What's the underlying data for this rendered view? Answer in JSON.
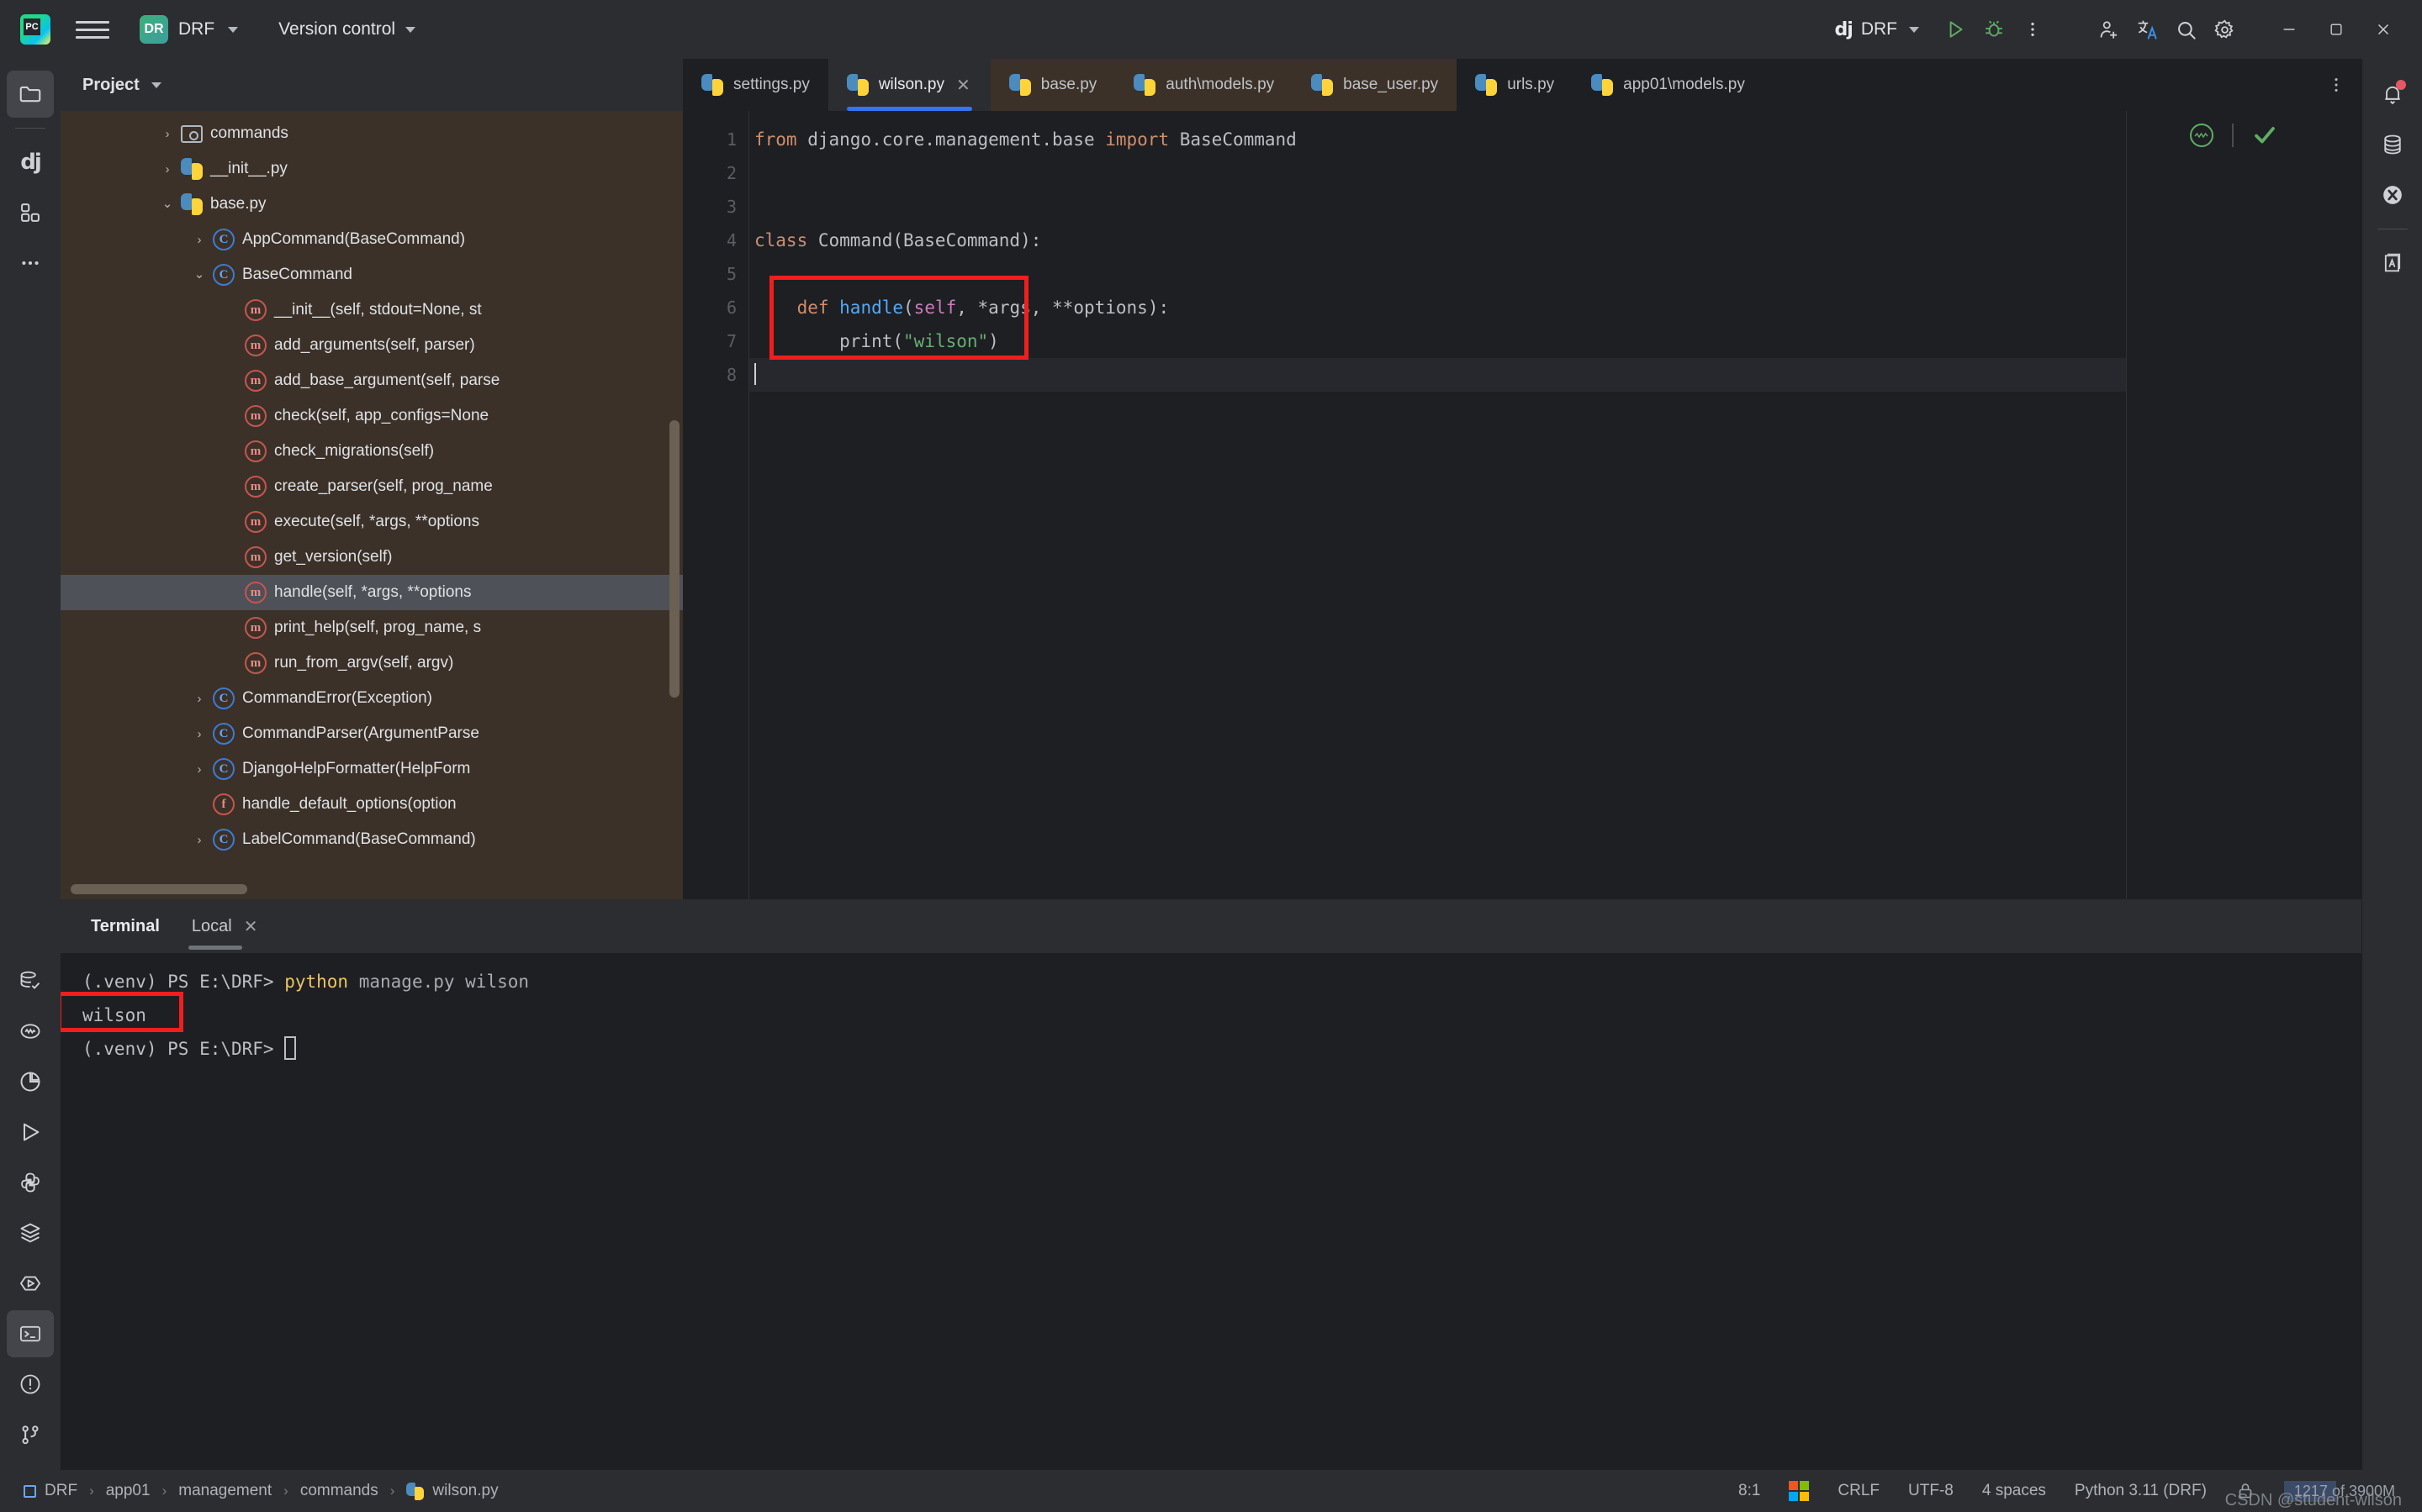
{
  "titlebar": {
    "menu_icon": "hamburger-menu-icon",
    "project_badge": "DR",
    "project_name": "DRF",
    "version_control": "Version control",
    "run_config_icon": "django-icon",
    "run_config_name": "DRF",
    "run_label": "Run",
    "debug_label": "Debug",
    "more_label": "More actions",
    "account_label": "Account",
    "translate_label": "Translate",
    "search_label": "Search everywhere",
    "settings_label": "Settings",
    "minimize_label": "Minimize",
    "maximize_label": "Restore",
    "close_label": "Close"
  },
  "left_rail": {
    "top": [
      {
        "name": "project-tool-window",
        "icon": "folder-icon",
        "active": true
      },
      {
        "name": "django-tool-window",
        "icon": "django-icon",
        "active": false
      },
      {
        "name": "structure-tool-window",
        "icon": "structure-icon",
        "active": false
      },
      {
        "name": "more-tool-windows",
        "icon": "more-horizontal-icon",
        "active": false
      }
    ],
    "bottom": [
      {
        "name": "database-tool-window",
        "icon": "database-check-icon",
        "active": false
      },
      {
        "name": "sql-console",
        "icon": "sql-wave-icon",
        "active": false
      },
      {
        "name": "profiler",
        "icon": "pie-chart-icon",
        "active": false
      },
      {
        "name": "run-tool-window",
        "icon": "play-icon",
        "active": false
      },
      {
        "name": "python-console",
        "icon": "python-icon",
        "active": false
      },
      {
        "name": "services",
        "icon": "layers-icon",
        "active": false
      },
      {
        "name": "endpoints",
        "icon": "hexagon-play-icon",
        "active": false
      },
      {
        "name": "terminal-tool-window",
        "icon": "terminal-icon",
        "active": true
      },
      {
        "name": "problems-tool-window",
        "icon": "alert-circle-icon",
        "active": false
      },
      {
        "name": "git-tool-window",
        "icon": "git-branch-icon",
        "active": false
      }
    ]
  },
  "right_rail": [
    {
      "name": "notifications",
      "icon": "bell-icon",
      "badge": true
    },
    {
      "name": "database",
      "icon": "database-icon",
      "badge": false
    },
    {
      "name": "plugin-x",
      "icon": "x-circle-icon",
      "badge": false
    },
    {
      "name": "dictionary",
      "icon": "book-a-icon",
      "badge": false
    }
  ],
  "project_pane": {
    "title": "Project",
    "tree": [
      {
        "indent": 3,
        "arrow": "right",
        "icon": "folder-icon",
        "label": "commands",
        "selected": false
      },
      {
        "indent": 3,
        "arrow": "right",
        "icon": "python-icon",
        "label": "__init__.py",
        "selected": false
      },
      {
        "indent": 3,
        "arrow": "down",
        "icon": "python-icon",
        "label": "base.py",
        "selected": false
      },
      {
        "indent": 4,
        "arrow": "right",
        "icon": "class-icon",
        "label": "AppCommand(BaseCommand)",
        "selected": false
      },
      {
        "indent": 4,
        "arrow": "down",
        "icon": "class-icon",
        "label": "BaseCommand",
        "selected": false
      },
      {
        "indent": 5,
        "arrow": "none",
        "icon": "method-icon",
        "label": "__init__(self, stdout=None, st",
        "selected": false
      },
      {
        "indent": 5,
        "arrow": "none",
        "icon": "method-icon",
        "label": "add_arguments(self, parser)",
        "selected": false
      },
      {
        "indent": 5,
        "arrow": "none",
        "icon": "method-icon",
        "label": "add_base_argument(self, parse",
        "selected": false
      },
      {
        "indent": 5,
        "arrow": "none",
        "icon": "method-icon",
        "label": "check(self, app_configs=None",
        "selected": false
      },
      {
        "indent": 5,
        "arrow": "none",
        "icon": "method-icon",
        "label": "check_migrations(self)",
        "selected": false
      },
      {
        "indent": 5,
        "arrow": "none",
        "icon": "method-icon",
        "label": "create_parser(self, prog_name",
        "selected": false
      },
      {
        "indent": 5,
        "arrow": "none",
        "icon": "method-icon",
        "label": "execute(self, *args, **options",
        "selected": false
      },
      {
        "indent": 5,
        "arrow": "none",
        "icon": "method-icon",
        "label": "get_version(self)",
        "selected": false
      },
      {
        "indent": 5,
        "arrow": "none",
        "icon": "method-icon",
        "label": "handle(self, *args, **options",
        "selected": true
      },
      {
        "indent": 5,
        "arrow": "none",
        "icon": "method-icon",
        "label": "print_help(self, prog_name, s",
        "selected": false
      },
      {
        "indent": 5,
        "arrow": "none",
        "icon": "method-icon",
        "label": "run_from_argv(self, argv)",
        "selected": false
      },
      {
        "indent": 4,
        "arrow": "right",
        "icon": "class-icon",
        "label": "CommandError(Exception)",
        "selected": false
      },
      {
        "indent": 4,
        "arrow": "right",
        "icon": "class-icon",
        "label": "CommandParser(ArgumentParse",
        "selected": false
      },
      {
        "indent": 4,
        "arrow": "right",
        "icon": "class-icon",
        "label": "DjangoHelpFormatter(HelpForm",
        "selected": false
      },
      {
        "indent": 4,
        "arrow": "none",
        "icon": "func-icon",
        "label": "handle_default_options(option",
        "selected": false
      },
      {
        "indent": 4,
        "arrow": "right",
        "icon": "class-icon",
        "label": "LabelCommand(BaseCommand)",
        "selected": false
      }
    ]
  },
  "editor": {
    "tabs": [
      {
        "label": "settings.py",
        "icon": "python-icon",
        "active": false,
        "group": false,
        "closable": false
      },
      {
        "label": "wilson.py",
        "icon": "python-icon",
        "active": true,
        "group": false,
        "closable": true
      },
      {
        "label": "base.py",
        "icon": "python-icon",
        "active": false,
        "group": true,
        "closable": false
      },
      {
        "label": "auth\\models.py",
        "icon": "python-icon",
        "active": false,
        "group": true,
        "closable": false
      },
      {
        "label": "base_user.py",
        "icon": "python-icon",
        "active": false,
        "group": true,
        "closable": false
      },
      {
        "label": "urls.py",
        "icon": "python-icon",
        "active": false,
        "group": false,
        "closable": false
      },
      {
        "label": "app01\\models.py",
        "icon": "python-icon",
        "active": false,
        "group": false,
        "closable": false
      }
    ],
    "tabs_more_icon": "more-vertical-icon",
    "line_numbers": [
      "1",
      "2",
      "3",
      "4",
      "5",
      "6",
      "7",
      "8"
    ],
    "code_lines": [
      [
        {
          "t": "from ",
          "c": "kw"
        },
        {
          "t": "django.core.management.base ",
          "c": "plain"
        },
        {
          "t": "import ",
          "c": "kw"
        },
        {
          "t": "BaseCommand",
          "c": "plain"
        }
      ],
      [],
      [],
      [
        {
          "t": "class ",
          "c": "kw"
        },
        {
          "t": "Command(BaseCommand):",
          "c": "plain"
        }
      ],
      [],
      [
        {
          "t": "    ",
          "c": "plain"
        },
        {
          "t": "def ",
          "c": "kw"
        },
        {
          "t": "handle",
          "c": "fn"
        },
        {
          "t": "(",
          "c": "plain"
        },
        {
          "t": "self",
          "c": "self"
        },
        {
          "t": ", *args, **options):",
          "c": "plain"
        }
      ],
      [
        {
          "t": "        print(",
          "c": "plain"
        },
        {
          "t": "\"wilson\"",
          "c": "str"
        },
        {
          "t": ")",
          "c": "plain"
        }
      ],
      []
    ],
    "gutter_marker_line": 6,
    "gutter_marker_icon": "method-override-icon",
    "inspection_status": "no-problems",
    "inspection_icons": [
      "inspection-widget-icon",
      "checkmark-icon"
    ]
  },
  "terminal": {
    "title": "Terminal",
    "tab_label": "Local",
    "close_icon": "close-icon",
    "lines": [
      [
        {
          "t": "(.venv) PS E:\\DRF> ",
          "c": "plain"
        },
        {
          "t": "python ",
          "c": "cmd"
        },
        {
          "t": "manage.py wilson",
          "c": "arg"
        }
      ],
      [
        {
          "t": "wilson",
          "c": "plain"
        }
      ],
      [
        {
          "t": "(.venv) PS E:\\DRF> ",
          "c": "plain"
        }
      ]
    ],
    "highlighted_output": "wilson"
  },
  "statusbar": {
    "breadcrumbs": [
      {
        "label": "DRF",
        "icon": "module-icon"
      },
      {
        "label": "app01",
        "icon": "none"
      },
      {
        "label": "management",
        "icon": "none"
      },
      {
        "label": "commands",
        "icon": "none"
      },
      {
        "label": "wilson.py",
        "icon": "python-icon"
      }
    ],
    "separator": "›",
    "caret_position": "8:1",
    "os_icon": "windows-icon",
    "line_separator": "CRLF",
    "encoding": "UTF-8",
    "indent": "4 spaces",
    "interpreter": "Python 3.11 (DRF)",
    "lock_icon": "lock-icon",
    "memory": "1217 of 3900M"
  },
  "watermark": "CSDN @student-wilson",
  "colors": {
    "accent_blue": "#3574F0",
    "annotation_red": "#F01E1E",
    "project_bg": "#3B3128",
    "editor_bg": "#1E1F22",
    "chrome_bg": "#2B2D30",
    "keyword": "#CF8E6D",
    "string": "#6AAB73",
    "function": "#56A8F5",
    "self_param": "#C77DBB",
    "green_ok": "#5FAD65"
  }
}
